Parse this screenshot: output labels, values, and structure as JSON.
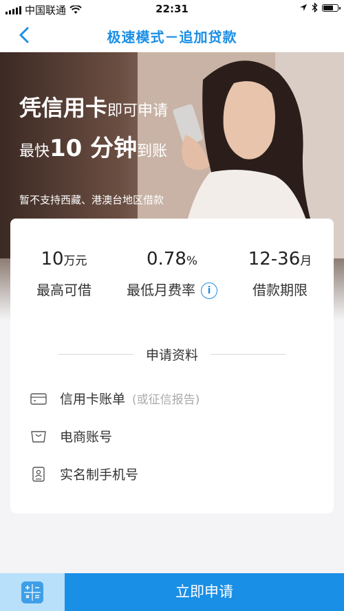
{
  "status_bar": {
    "carrier": "中国联通",
    "time": "22:31",
    "icons": [
      "signal-icon",
      "wifi-icon",
      "location-icon",
      "bluetooth-icon",
      "battery-icon"
    ]
  },
  "nav": {
    "title": "极速模式－追加贷款",
    "back_icon": "chevron-left-icon"
  },
  "hero": {
    "line1_big": "凭信用卡",
    "line1_small": "即可申请",
    "line2_prefix": "最快",
    "line2_big": "10 分钟",
    "line2_suffix": "到账",
    "note": "暂不支持西藏、港澳台地区借款"
  },
  "stats": [
    {
      "value": "10",
      "unit": "万元",
      "label": "最高可借"
    },
    {
      "value": "0.78",
      "unit": "%",
      "label": "最低月费率",
      "icon": "info-icon"
    },
    {
      "value": "12-36",
      "unit": "月",
      "label": "借款期限"
    }
  ],
  "materials": {
    "title": "申请资料",
    "items": [
      {
        "icon": "credit-card-icon",
        "name": "信用卡账单",
        "hint": "(或征信报告)"
      },
      {
        "icon": "shopping-bag-icon",
        "name": "电商账号",
        "hint": ""
      },
      {
        "icon": "id-phone-icon",
        "name": "实名制手机号",
        "hint": ""
      }
    ]
  },
  "bottom": {
    "calculator_icon": "calculator-icon",
    "apply_label": "立即申请"
  },
  "colors": {
    "accent": "#1a8fe6",
    "calculator_bg": "#b9e0fa"
  }
}
